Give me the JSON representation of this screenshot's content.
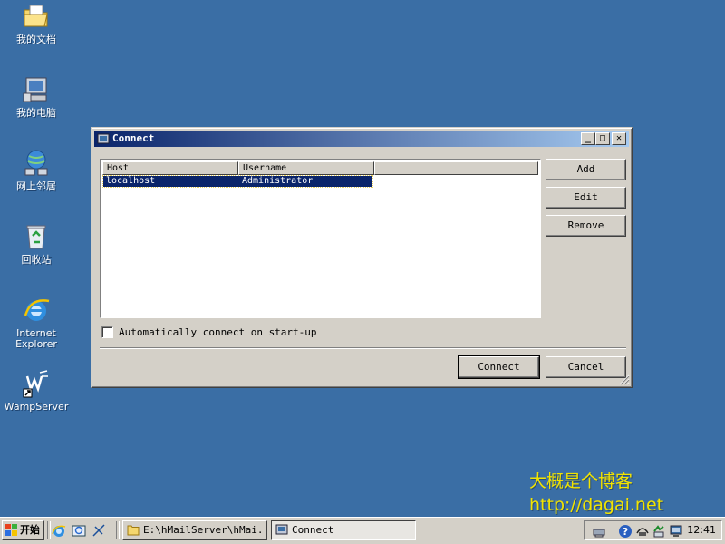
{
  "desktop": {
    "icons": [
      {
        "label": "我的文档",
        "icon": "my-documents-icon"
      },
      {
        "label": "我的电脑",
        "icon": "my-computer-icon"
      },
      {
        "label": "网上邻居",
        "icon": "network-places-icon"
      },
      {
        "label": "回收站",
        "icon": "recycle-bin-icon"
      },
      {
        "label_line1": "Internet",
        "label_line2": "Explorer",
        "icon": "internet-explorer-icon"
      },
      {
        "label": "WampServer",
        "icon": "wampserver-icon"
      }
    ],
    "background_color": "#3a6ea5"
  },
  "watermark": {
    "line1": "大概是个博客",
    "line2": "http://dagai.net",
    "color": "#f2e400"
  },
  "window": {
    "title": "Connect",
    "title_icon": "app-icon",
    "controls": {
      "minimize": "_",
      "maximize": "□",
      "close": "✕"
    },
    "list": {
      "columns": [
        "Host",
        "Username"
      ],
      "rows": [
        {
          "host": "localhost",
          "username": "Administrator",
          "selected": true
        }
      ]
    },
    "side_buttons": {
      "add": "Add",
      "edit": "Edit",
      "remove": "Remove"
    },
    "auto_connect": {
      "label": "Automatically connect on start-up",
      "checked": false
    },
    "footer_buttons": {
      "connect": "Connect",
      "cancel": "Cancel"
    }
  },
  "taskbar": {
    "start_label": "开始",
    "quick_launch": [
      "internet-explorer-icon",
      "outlook-express-icon",
      "show-desktop-icon"
    ],
    "tasks": [
      {
        "label": "E:\\hMailServer\\hMai...",
        "icon": "folder-icon",
        "active": false
      },
      {
        "label": "Connect",
        "icon": "app-icon",
        "active": true
      }
    ],
    "tray_icons": [
      "network-icon",
      "help-icon",
      "volume-icon",
      "sync-icon",
      "monitor-icon"
    ],
    "clock": "12:41"
  }
}
